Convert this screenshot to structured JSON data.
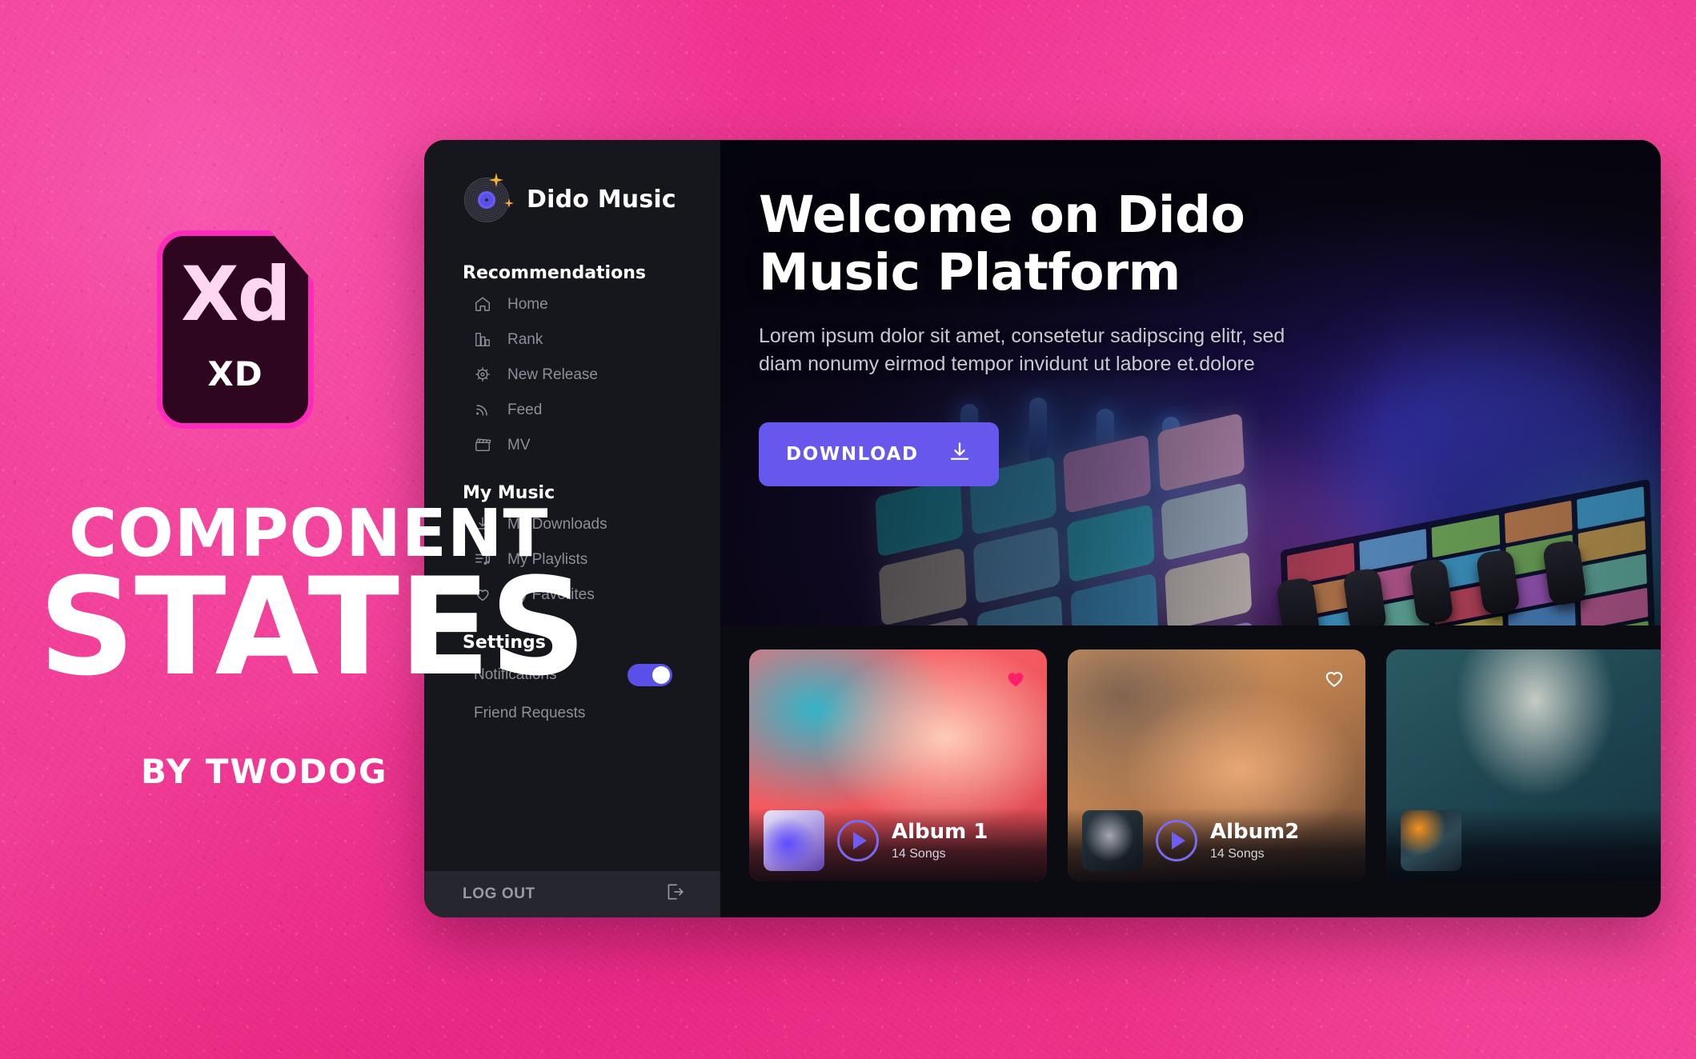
{
  "branding": {
    "xd_letters": "Xd",
    "xd_label": "XD",
    "title_line1": "COMPONENT",
    "title_line2": "STATES",
    "byline": "BY TWODOG"
  },
  "app": {
    "sidebar": {
      "brand_name": "Dido Music",
      "brand_icon": "vinyl-record-icon",
      "sections": [
        {
          "heading": "Recommendations",
          "items": [
            {
              "label": "Home",
              "icon": "home-icon"
            },
            {
              "label": "Rank",
              "icon": "chart-bars-icon"
            },
            {
              "label": "New Release",
              "icon": "new-release-icon"
            },
            {
              "label": "Feed",
              "icon": "rss-feed-icon"
            },
            {
              "label": "MV",
              "icon": "clapperboard-icon"
            }
          ]
        },
        {
          "heading": "My Music",
          "items": [
            {
              "label": "My Downloads",
              "icon": "download-icon"
            },
            {
              "label": "My Playlists",
              "icon": "playlist-icon"
            },
            {
              "label": "My Favorites",
              "icon": "heart-outline-icon"
            }
          ]
        }
      ],
      "settings": {
        "heading": "Settings",
        "notifications_label": "Notifications",
        "notifications_on": "on",
        "friend_requests_label": "Friend Requests"
      },
      "logout": {
        "label": "LOG OUT",
        "icon": "logout-arrow-icon"
      }
    },
    "hero": {
      "title_line1": "Welcome on Dido",
      "title_line2": "Music Platform",
      "subtitle_line1": "Lorem ipsum dolor sit amet, consetetur sadipscing elitr, sed",
      "subtitle_line2": "diam nonumy eirmod tempor invidunt ut labore et.dolore",
      "download_label": "DOWNLOAD",
      "download_icon": "download-icon"
    },
    "cards": [
      {
        "title": "Album 1",
        "songs": "14 Songs",
        "favorited": true,
        "heart_icon": "heart-filled-icon",
        "play_icon": "play-icon"
      },
      {
        "title": "Album2",
        "songs": "14 Songs",
        "favorited": false,
        "heart_icon": "heart-outline-icon",
        "play_icon": "play-icon"
      },
      {
        "title": "",
        "songs": "",
        "favorited": false,
        "heart_icon": "heart-outline-icon",
        "play_icon": "play-icon"
      }
    ]
  },
  "colors": {
    "background_pink": "#ee2f8c",
    "accent_purple": "#6658ec",
    "sidebar_bg": "#16161d",
    "logout_bar_bg": "#26262e",
    "heart_filled": "#ff1f6a",
    "xd_badge_bg": "#2e0620",
    "xd_badge_border": "#ff2bbb"
  }
}
